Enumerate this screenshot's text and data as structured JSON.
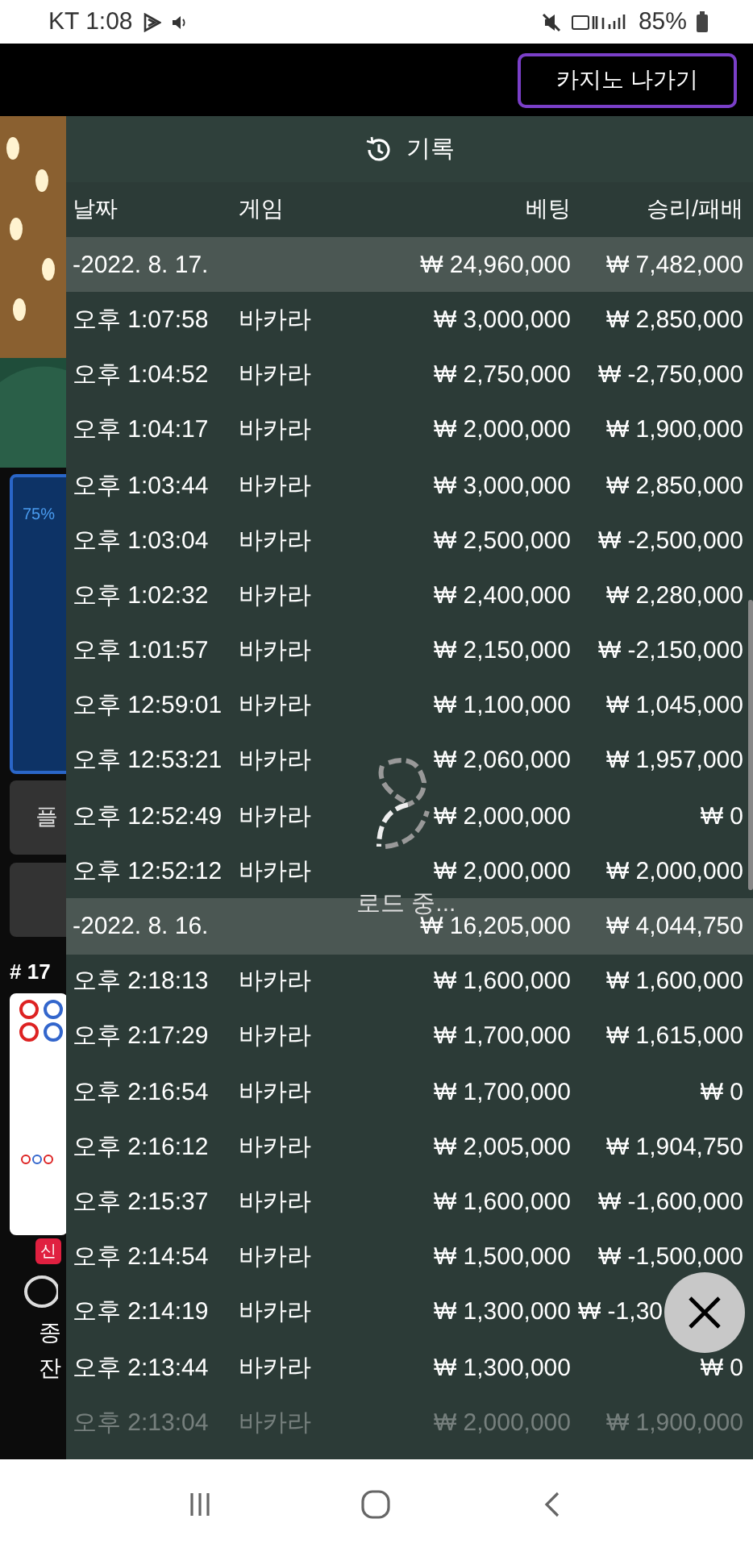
{
  "status_bar": {
    "carrier": "KT",
    "time": "1:08",
    "battery": "85%"
  },
  "exit_button": "카지노 나가기",
  "background": {
    "progress": "75%",
    "button_label": "플",
    "table_number": "# 17",
    "badge": "신",
    "labels": [
      "종",
      "잔"
    ]
  },
  "panel": {
    "title": "기록",
    "columns": [
      "날짜",
      "게임",
      "베팅",
      "승리/패배"
    ],
    "groups": [
      {
        "date": "-2022. 8. 17.",
        "total_bet": "₩ 24,960,000",
        "total_result": "₩ 7,482,000",
        "rows": [
          {
            "time": "오후 1:07:58",
            "game": "바카라",
            "bet": "₩ 3,000,000",
            "result": "₩ 2,850,000"
          },
          {
            "time": "오후 1:04:52",
            "game": "바카라",
            "bet": "₩ 2,750,000",
            "result": "₩ -2,750,000"
          },
          {
            "time": "오후 1:04:17",
            "game": "바카라",
            "bet": "₩ 2,000,000",
            "result": "₩ 1,900,000"
          },
          {
            "time": "오후 1:03:44",
            "game": "바카라",
            "bet": "₩ 3,000,000",
            "result": "₩ 2,850,000"
          },
          {
            "time": "오후 1:03:04",
            "game": "바카라",
            "bet": "₩ 2,500,000",
            "result": "₩ -2,500,000"
          },
          {
            "time": "오후 1:02:32",
            "game": "바카라",
            "bet": "₩ 2,400,000",
            "result": "₩ 2,280,000"
          },
          {
            "time": "오후 1:01:57",
            "game": "바카라",
            "bet": "₩ 2,150,000",
            "result": "₩ -2,150,000"
          },
          {
            "time": "오후 12:59:01",
            "game": "바카라",
            "bet": "₩ 1,100,000",
            "result": "₩ 1,045,000"
          },
          {
            "time": "오후 12:53:21",
            "game": "바카라",
            "bet": "₩ 2,060,000",
            "result": "₩ 1,957,000"
          },
          {
            "time": "오후 12:52:49",
            "game": "바카라",
            "bet": "₩ 2,000,000",
            "result": "₩ 0"
          },
          {
            "time": "오후 12:52:12",
            "game": "바카라",
            "bet": "₩ 2,000,000",
            "result": "₩ 2,000,000"
          }
        ]
      },
      {
        "date": "-2022. 8. 16.",
        "total_bet": "₩ 16,205,000",
        "total_result": "₩ 4,044,750",
        "rows": [
          {
            "time": "오후 2:18:13",
            "game": "바카라",
            "bet": "₩ 1,600,000",
            "result": "₩ 1,600,000"
          },
          {
            "time": "오후 2:17:29",
            "game": "바카라",
            "bet": "₩ 1,700,000",
            "result": "₩ 1,615,000"
          },
          {
            "time": "오후 2:16:54",
            "game": "바카라",
            "bet": "₩ 1,700,000",
            "result": "₩ 0"
          },
          {
            "time": "오후 2:16:12",
            "game": "바카라",
            "bet": "₩ 2,005,000",
            "result": "₩ 1,904,750"
          },
          {
            "time": "오후 2:15:37",
            "game": "바카라",
            "bet": "₩ 1,600,000",
            "result": "₩ -1,600,000"
          },
          {
            "time": "오후 2:14:54",
            "game": "바카라",
            "bet": "₩ 1,500,000",
            "result": "₩ -1,500,000"
          },
          {
            "time": "오후 2:14:19",
            "game": "바카라",
            "bet": "₩ 1,300,000",
            "result": "₩ -1,30",
            "covered": true
          },
          {
            "time": "오후 2:13:44",
            "game": "바카라",
            "bet": "₩ 1,300,000",
            "result": "₩ 0"
          },
          {
            "time": "오후 2:13:04",
            "game": "바카라",
            "bet": "₩ 2,000,000",
            "result": "₩ 1,900,000"
          }
        ]
      }
    ]
  },
  "loading": "로드 중..."
}
